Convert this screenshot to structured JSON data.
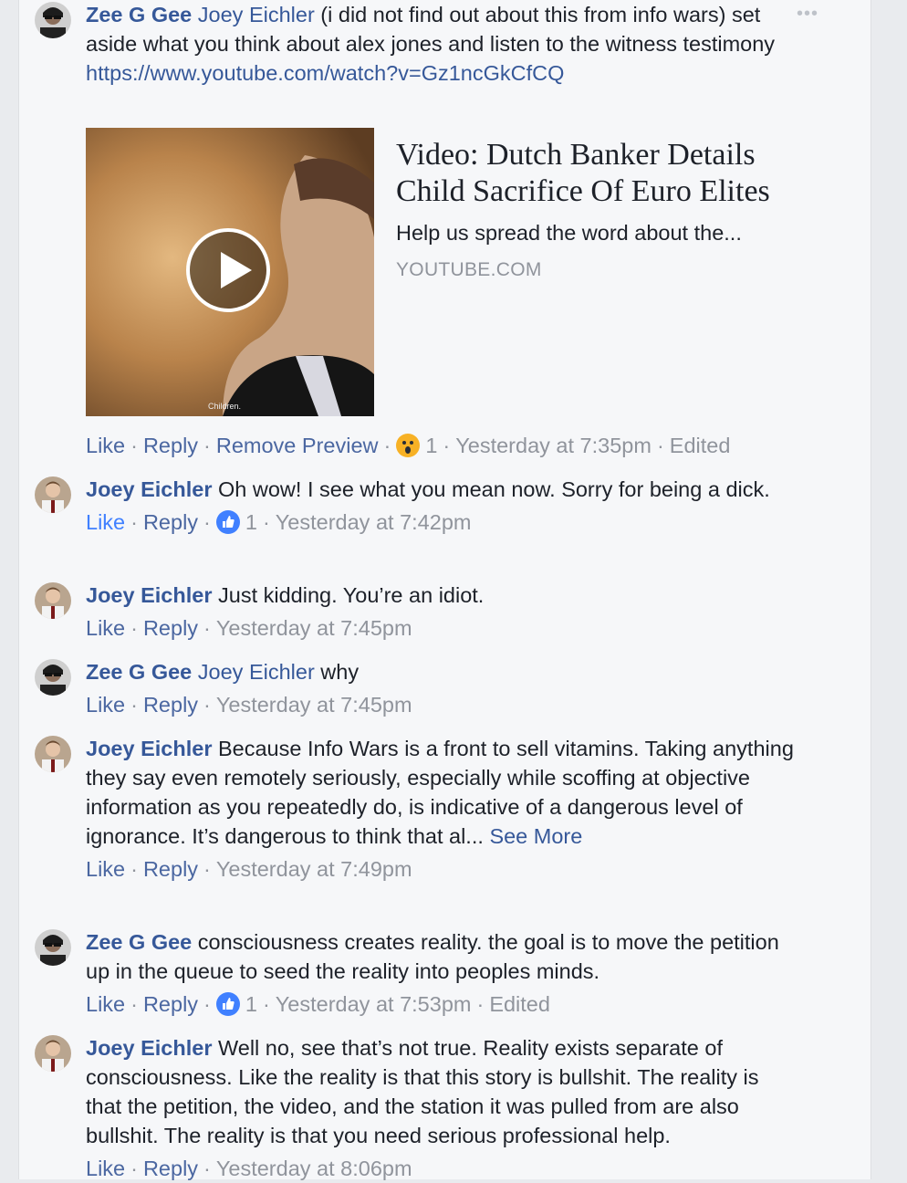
{
  "more_menu": "•••",
  "c1": {
    "author": "Zee G Gee",
    "tag": "Joey Eichler",
    "text": " (i did not find out about this from info wars) set aside what you think about alex jones and listen to the witness testimony",
    "link": "https://www.youtube.com/watch?v=Gz1ncGkCfCQ",
    "preview": {
      "title": "Video: Dutch Banker Details Child Sacrifice Of Euro Elites",
      "description": "Help us spread the word about the...",
      "source": "YOUTUBE.COM",
      "thumb_caption": "Children."
    },
    "like": "Like",
    "reply": "Reply",
    "remove_preview": "Remove Preview",
    "reaction_icon": "wow-icon",
    "reaction_count": "1",
    "time": "Yesterday at 7:35pm",
    "edited": "Edited"
  },
  "c2": {
    "author": "Joey Eichler",
    "text": " Oh wow! I see what you mean now. Sorry for being a dick.",
    "like": "Like",
    "reply": "Reply",
    "reaction_icon": "like-icon",
    "reaction_count": "1",
    "time": "Yesterday at 7:42pm"
  },
  "c3": {
    "author": "Joey Eichler",
    "text": " Just kidding. You’re an idiot.",
    "like": "Like",
    "reply": "Reply",
    "time": "Yesterday at 7:45pm"
  },
  "c4": {
    "author": "Zee G Gee",
    "tag": "Joey Eichler",
    "text": " why",
    "like": "Like",
    "reply": "Reply",
    "time": "Yesterday at 7:45pm"
  },
  "c5": {
    "author": "Joey Eichler",
    "text": " Because Info Wars is a front to sell vitamins. Taking anything they say even remotely seriously, especially while scoffing at objective information as you repeatedly do, is indicative of a dangerous level of ignorance. It’s dangerous to think that al...",
    "see_more": "See More",
    "like": "Like",
    "reply": "Reply",
    "time": "Yesterday at 7:49pm"
  },
  "c6": {
    "author": "Zee G Gee",
    "text": " consciousness creates reality. the goal is to move the petition up in the queue to seed the reality into peoples minds.",
    "like": "Like",
    "reply": "Reply",
    "reaction_icon": "like-icon",
    "reaction_count": "1",
    "time": "Yesterday at 7:53pm",
    "edited": "Edited"
  },
  "c7": {
    "author": "Joey Eichler",
    "text": " Well no, see that’s not true. Reality exists separate of consciousness. Like the reality is that this story is bullshit. The reality is that the petition, the video, and the station it was pulled from are also bullshit. The reality is that you need serious professional help.",
    "like": "Like",
    "reply": "Reply",
    "time": "Yesterday at 8:06pm"
  },
  "colors": {
    "link": "#365899",
    "meta": "#90949c",
    "liked": "#4080ff",
    "background": "#f6f7f9"
  }
}
